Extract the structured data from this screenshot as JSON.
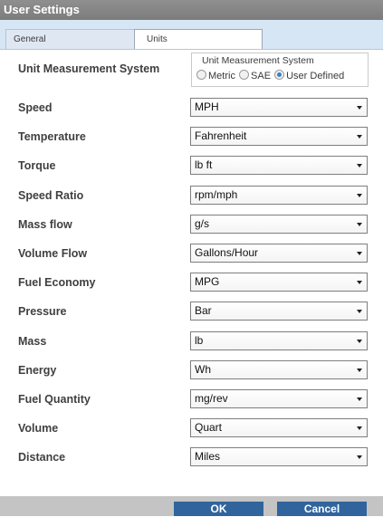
{
  "window": {
    "title": "User Settings"
  },
  "tabs": [
    {
      "label": "General",
      "selected": false
    },
    {
      "label": "Units",
      "selected": true
    }
  ],
  "unit_system": {
    "label": "Unit Measurement System",
    "group_title": "Unit Measurement System",
    "options": [
      {
        "label": "Metric",
        "checked": false
      },
      {
        "label": "SAE",
        "checked": false
      },
      {
        "label": "User Defined",
        "checked": true
      }
    ]
  },
  "fields": [
    {
      "label": "Speed",
      "value": "MPH"
    },
    {
      "label": "Temperature",
      "value": "Fahrenheit"
    },
    {
      "label": "Torque",
      "value": "lb ft"
    },
    {
      "label": "Speed Ratio",
      "value": "rpm/mph"
    },
    {
      "label": "Mass flow",
      "value": "g/s"
    },
    {
      "label": "Volume Flow",
      "value": "Gallons/Hour"
    },
    {
      "label": "Fuel Economy",
      "value": "MPG"
    },
    {
      "label": "Pressure",
      "value": "Bar"
    },
    {
      "label": "Mass",
      "value": "lb"
    },
    {
      "label": "Energy",
      "value": "Wh"
    },
    {
      "label": "Fuel Quantity",
      "value": "mg/rev"
    },
    {
      "label": "Volume",
      "value": "Quart"
    },
    {
      "label": "Distance",
      "value": "Miles"
    }
  ],
  "buttons": {
    "ok": "OK",
    "cancel": "Cancel"
  }
}
